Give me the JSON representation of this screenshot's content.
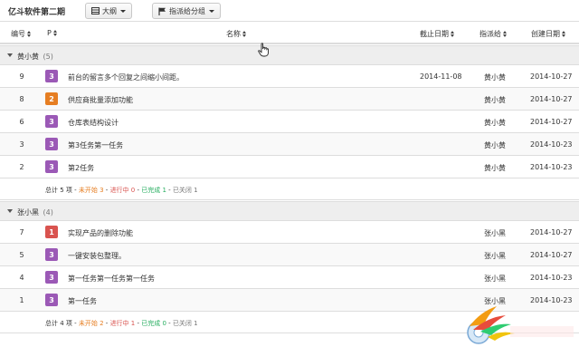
{
  "toolbar": {
    "project_title": "亿斗软件第二期",
    "outline_label": "大纲",
    "group_label": "指派给分组"
  },
  "columns": {
    "id": "编号",
    "priority": "P",
    "name": "名称",
    "deadline": "截止日期",
    "assignee": "指派给",
    "created": "创建日期"
  },
  "colors": {
    "purple": "#9b59b6",
    "orange": "#e67e22",
    "red": "#d9534f",
    "not_started": "#e67e22",
    "in_progress": "#d9534f",
    "done": "#27ae60"
  },
  "groups": [
    {
      "name": "黄小黄",
      "count": "(5)",
      "rows": [
        {
          "id": "9",
          "priority": "3",
          "color": "#9b59b6",
          "name": "前台的留言多个回复之间缩小间距。",
          "deadline": "2014-11-08",
          "assignee": "黄小黄",
          "created": "2014-10-27"
        },
        {
          "id": "8",
          "priority": "2",
          "color": "#e67e22",
          "name": "供应商批量添加功能",
          "deadline": "",
          "assignee": "黄小黄",
          "created": "2014-10-27"
        },
        {
          "id": "6",
          "priority": "3",
          "color": "#9b59b6",
          "name": "仓库表结构设计",
          "deadline": "",
          "assignee": "黄小黄",
          "created": "2014-10-27"
        },
        {
          "id": "3",
          "priority": "3",
          "color": "#9b59b6",
          "name": "第3任务第一任务",
          "deadline": "",
          "assignee": "黄小黄",
          "created": "2014-10-23"
        },
        {
          "id": "2",
          "priority": "3",
          "color": "#9b59b6",
          "name": "第2任务",
          "deadline": "",
          "assignee": "黄小黄",
          "created": "2014-10-23"
        }
      ],
      "summary": {
        "total": "总计 5 项 - ",
        "not_started": "未开始 3",
        "sep1": " - ",
        "in_progress": "进行中 0",
        "sep2": " - ",
        "done": "已完成 1",
        "sep3": " - ",
        "closed": "已关闭 1"
      }
    },
    {
      "name": "张小黑",
      "count": "(4)",
      "rows": [
        {
          "id": "7",
          "priority": "1",
          "color": "#d9534f",
          "name": "实现产品的删除功能",
          "deadline": "",
          "assignee": "张小黑",
          "created": "2014-10-27"
        },
        {
          "id": "5",
          "priority": "3",
          "color": "#9b59b6",
          "name": "一键安装包整理。",
          "deadline": "",
          "assignee": "张小黑",
          "created": "2014-10-27"
        },
        {
          "id": "4",
          "priority": "3",
          "color": "#9b59b6",
          "name": "第一任务第一任务第一任务",
          "deadline": "",
          "assignee": "张小黑",
          "created": "2014-10-23"
        },
        {
          "id": "1",
          "priority": "3",
          "color": "#9b59b6",
          "name": "第一任务",
          "deadline": "",
          "assignee": "张小黑",
          "created": "2014-10-23"
        }
      ],
      "summary": {
        "total": "总计 4 项 - ",
        "not_started": "未开始 2",
        "sep1": " - ",
        "in_progress": "进行中 1",
        "sep2": " - ",
        "done": "已完成 0",
        "sep3": " - ",
        "closed": "已关闭 1"
      }
    }
  ],
  "icons": {
    "outline": "list-icon",
    "group": "flag-icon",
    "cursor": "hand-cursor-icon",
    "logo": "watermark-logo"
  }
}
